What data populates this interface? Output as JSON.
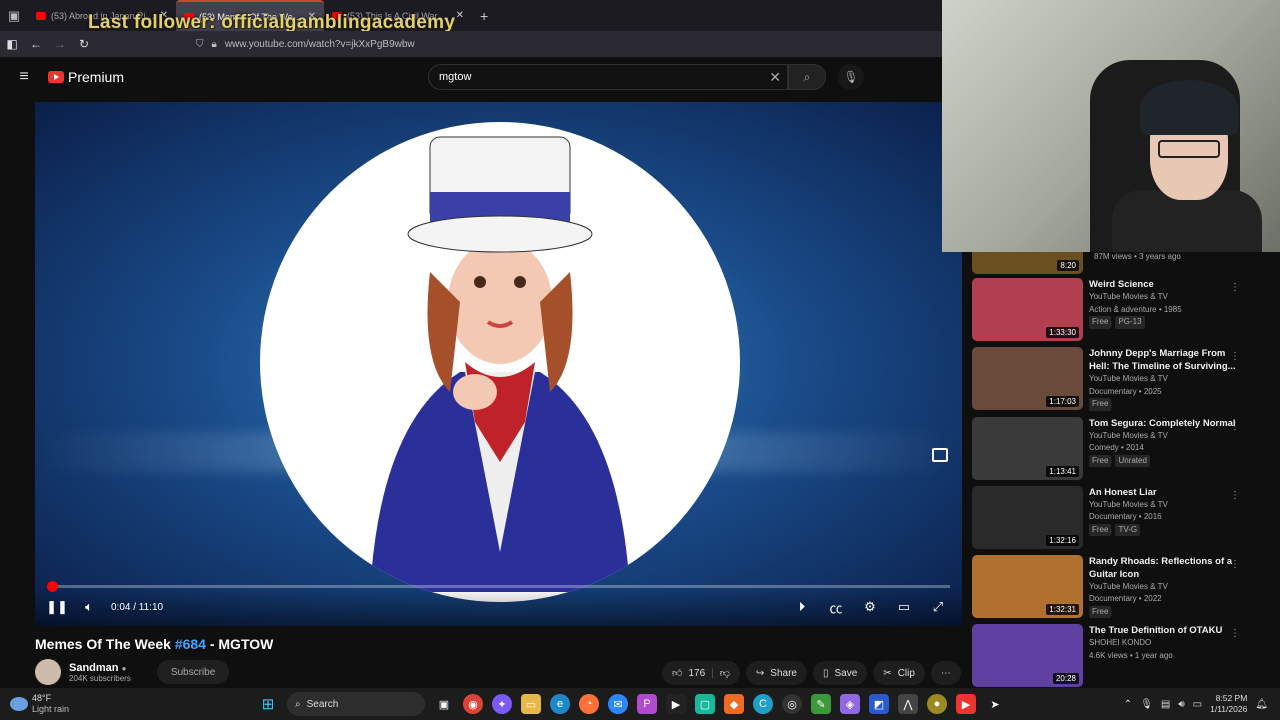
{
  "browser": {
    "tabs": [
      {
        "label": "(53) Abroad in Japan Risks Deat"
      },
      {
        "label": "(53) Memes Of The Week #"
      },
      {
        "label": "(53) This Is A Civil War - YouTub"
      }
    ],
    "url": "www.youtube.com/watch?v=jkXxPgB9wbw",
    "overlay_text": "Last follower: officialgamblingacademy"
  },
  "youtube": {
    "logo_text": "Premium",
    "search_value": "mgtow"
  },
  "player": {
    "time": "0:04 / 11:10",
    "progress": 0.006
  },
  "video": {
    "title_prefix": "Memes Of The Week ",
    "title_tag": "#684",
    "title_suffix": " - MGTOW",
    "channel": "Sandman",
    "subscribers": "204K subscribers",
    "subscribe_label": "Subscribe",
    "likes": "176",
    "share_label": "Share",
    "save_label": "Save",
    "clip_label": "Clip"
  },
  "sidebar": {
    "top_meta": "87M views • 3 years ago",
    "top_duration": "8:20",
    "items": [
      {
        "title": "Weird Science",
        "channel": "YouTube Movies & TV",
        "meta": "Action & adventure • 1985",
        "badges": [
          "Free",
          "PG-13"
        ],
        "duration": "1:33:30",
        "thumb": "#b04050"
      },
      {
        "title": "Johnny Depp's Marriage From Hell: The Timeline of Surviving...",
        "channel": "YouTube Movies & TV",
        "meta": "Documentary • 2025",
        "badges": [
          "Free"
        ],
        "duration": "1:17:03",
        "thumb": "#6a4a3a"
      },
      {
        "title": "Tom Segura: Completely Normal",
        "channel": "YouTube Movies & TV",
        "meta": "Comedy • 2014",
        "badges": [
          "Free",
          "Unrated"
        ],
        "duration": "1:13:41",
        "thumb": "#3a3a3a"
      },
      {
        "title": "An Honest Liar",
        "channel": "YouTube Movies & TV",
        "meta": "Documentary • 2016",
        "badges": [
          "Free",
          "TV-G"
        ],
        "duration": "1:32:16",
        "thumb": "#2a2a2a"
      },
      {
        "title": "Randy Rhoads: Reflections of a Guitar Icon",
        "channel": "YouTube Movies & TV",
        "meta": "Documentary • 2022",
        "badges": [
          "Free"
        ],
        "duration": "1:32:31",
        "thumb": "#b07030"
      },
      {
        "title": "The True Definition of OTAKU",
        "channel": "SHOHEI KONDO",
        "meta": "4.6K views • 1 year ago",
        "badges": [],
        "duration": "20:28",
        "thumb": "#6040a0"
      }
    ]
  },
  "taskbar": {
    "temperature": "48°F",
    "weather": "Light rain",
    "search_label": "Search",
    "time": "8:52 PM",
    "date": "1/11/2026"
  }
}
